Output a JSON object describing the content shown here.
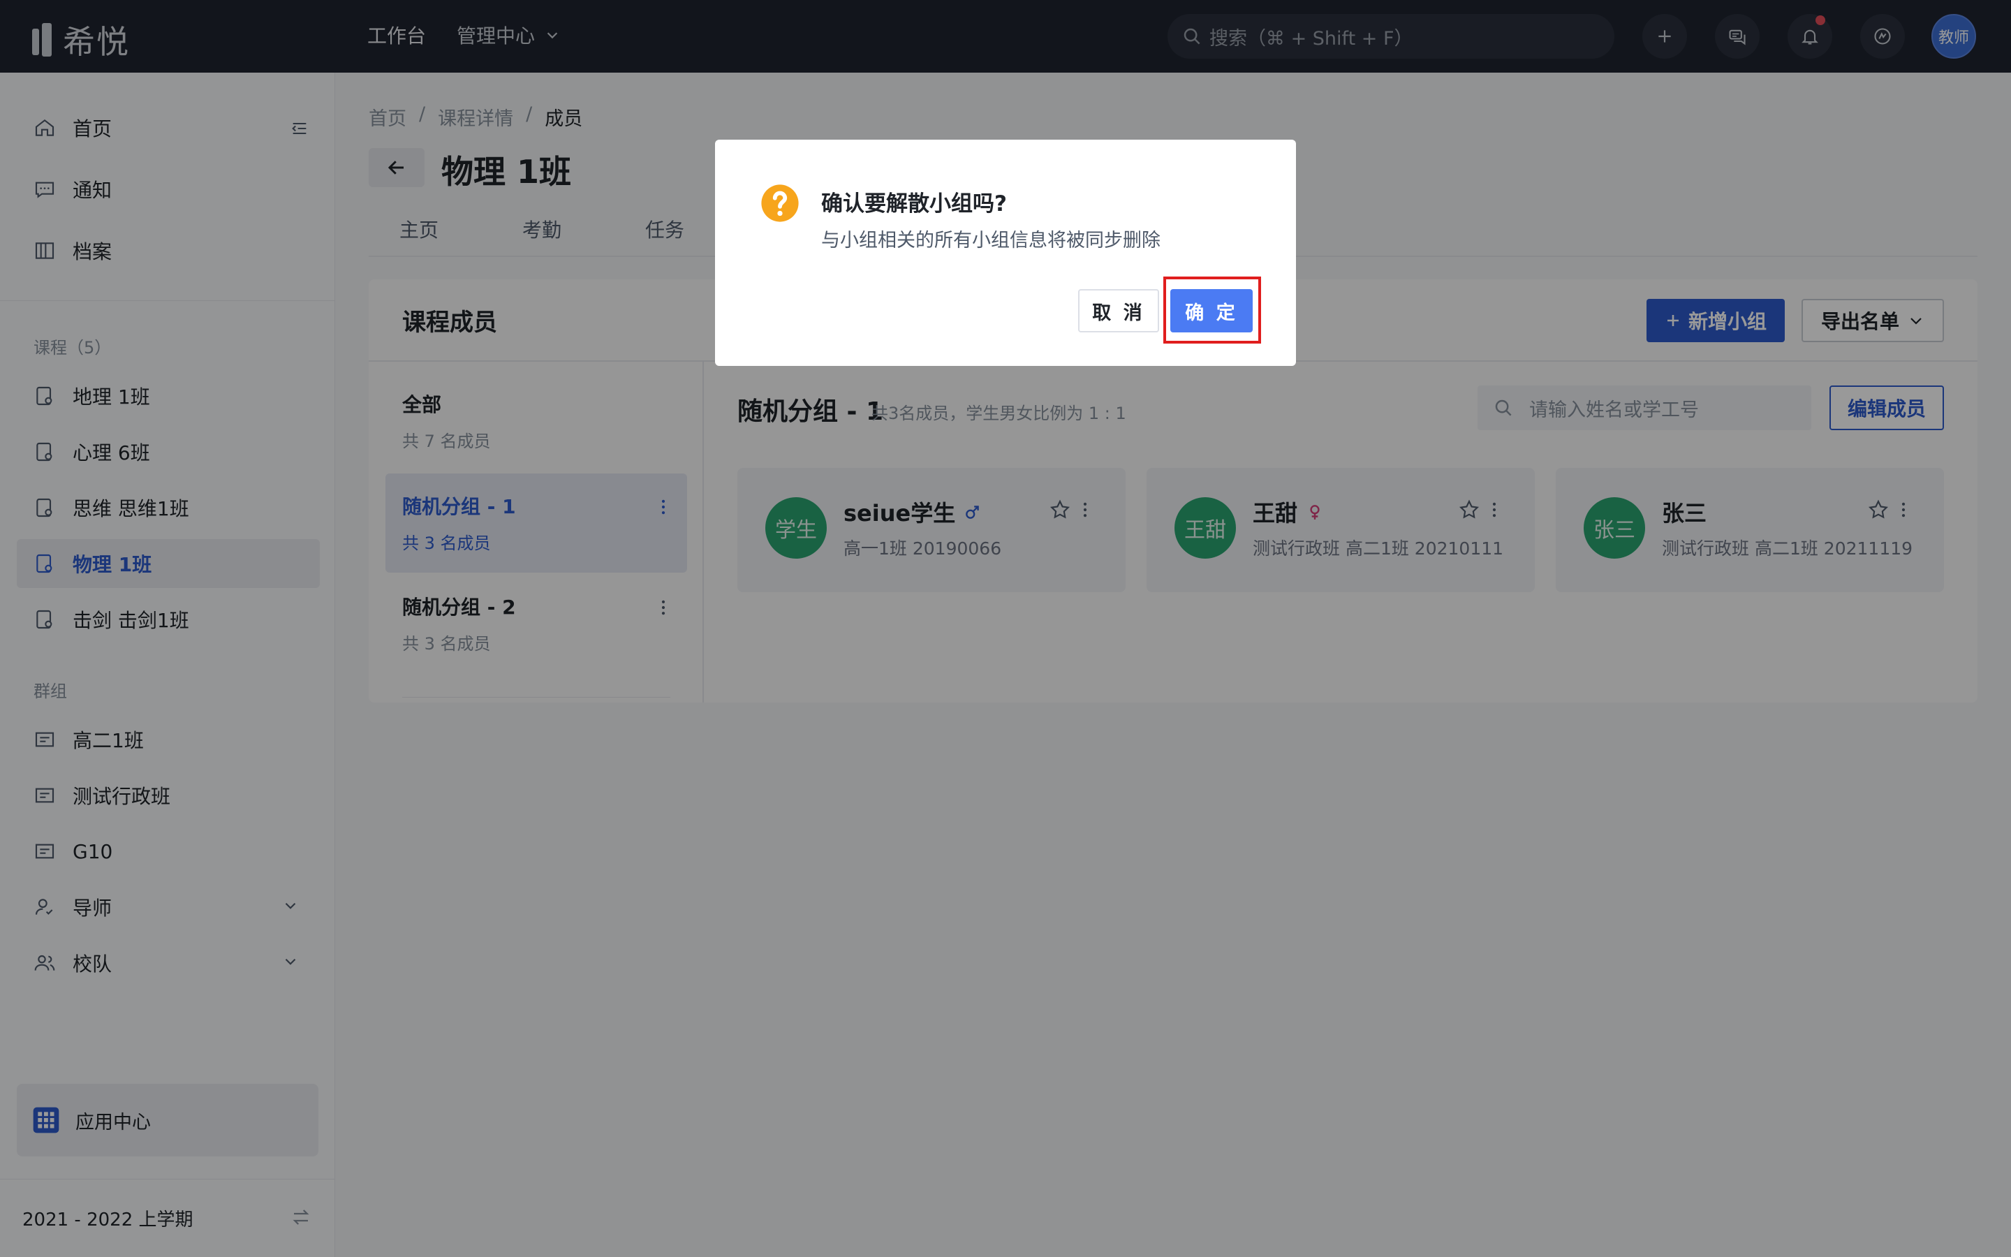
{
  "app": {
    "name": "希悦"
  },
  "topnav": {
    "workbench": "工作台",
    "admin": "管理中心",
    "search_placeholder": "搜索（⌘ + Shift + F）",
    "avatar": "教师"
  },
  "sidebar": {
    "home": "首页",
    "notice": "通知",
    "archive": "档案",
    "courses_title": "课程（5）",
    "courses": [
      "地理 1班",
      "心理 6班",
      "思维 思维1班",
      "物理 1班",
      "击剑 击剑1班"
    ],
    "groups_title": "群组",
    "groups": [
      "高二1班",
      "测试行政班",
      "G10"
    ],
    "mentor": "导师",
    "team": "校队",
    "app_center": "应用中心",
    "semester": "2021 - 2022 上学期"
  },
  "breadcrumb": [
    "首页",
    "课程详情",
    "成员"
  ],
  "page": {
    "title": "物理 1班",
    "tabs": [
      "主页",
      "考勤",
      "任务"
    ]
  },
  "panel": {
    "title": "课程成员",
    "add_group": "新增小组",
    "export": "导出名单",
    "group_list": [
      {
        "name": "全部",
        "count": "共 7 名成员"
      },
      {
        "name": "随机分组 - 1",
        "count": "共 3 名成员"
      },
      {
        "name": "随机分组 - 2",
        "count": "共 3 名成员"
      }
    ],
    "detail_title": "随机分组 - 1",
    "detail_meta": "共3名成员，学生男女比例为 1 : 1",
    "search_placeholder": "请输入姓名或学工号",
    "edit_members": "编辑成员",
    "members": [
      {
        "avatar": "学生",
        "name": "seiue学生",
        "sub": "高一1班 20190066",
        "gender": "male"
      },
      {
        "avatar": "王甜",
        "name": "王甜",
        "sub": "测试行政班 高二1班 20210111",
        "gender": "female"
      },
      {
        "avatar": "张三",
        "name": "张三",
        "sub": "测试行政班 高二1班 20211119",
        "gender": ""
      }
    ]
  },
  "modal": {
    "title": "确认要解散小组吗?",
    "desc": "与小组相关的所有小组信息将被同步删除",
    "cancel": "取 消",
    "ok": "确 定"
  },
  "colors": {
    "accent": "#2d5bcc",
    "modal_ok": "#4b7bf3",
    "avatar_green": "#2ba471",
    "warning": "#f7a51c",
    "highlight": "#e01e1e"
  }
}
